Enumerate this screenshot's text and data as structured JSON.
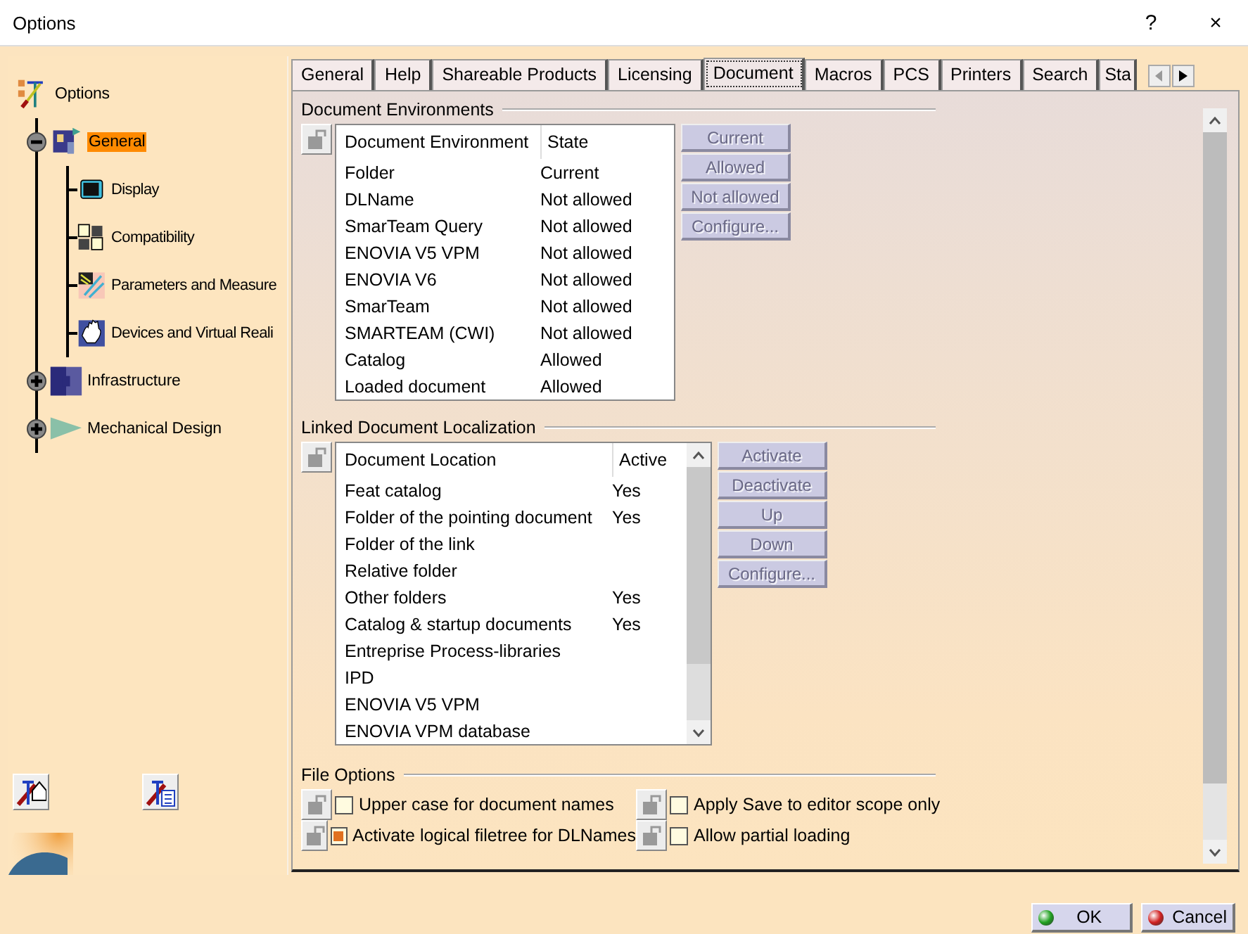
{
  "window": {
    "title": "Options",
    "help": "?",
    "close": "×"
  },
  "tree": {
    "label": "Options",
    "children": [
      {
        "label": "General",
        "selected": true,
        "expanded": true,
        "children": [
          {
            "label": "Display",
            "selected": false
          },
          {
            "label": "Compatibility",
            "selected": false
          },
          {
            "label": "Parameters and Measure",
            "selected": false
          },
          {
            "label": "Devices and Virtual Reali",
            "selected": false
          }
        ]
      },
      {
        "label": "Infrastructure",
        "selected": false,
        "expanded": false
      },
      {
        "label": "Mechanical Design",
        "selected": false,
        "expanded": false
      }
    ]
  },
  "tabs": [
    {
      "label": "General",
      "selected": false
    },
    {
      "label": "Help",
      "selected": false
    },
    {
      "label": "Shareable Products",
      "selected": false
    },
    {
      "label": "Licensing",
      "selected": false
    },
    {
      "label": "Document",
      "selected": true
    },
    {
      "label": "Macros",
      "selected": false
    },
    {
      "label": "PCS",
      "selected": false
    },
    {
      "label": "Printers",
      "selected": false
    },
    {
      "label": "Search",
      "selected": false
    },
    {
      "label": "Sta",
      "selected": false
    }
  ],
  "document_environments": {
    "title": "Document Environments",
    "columns": [
      "Document Environment",
      "State"
    ],
    "rows": [
      {
        "name": "Folder",
        "state": "Current"
      },
      {
        "name": "DLName",
        "state": "Not allowed"
      },
      {
        "name": "SmarTeam Query",
        "state": "Not allowed"
      },
      {
        "name": "ENOVIA V5 VPM",
        "state": "Not allowed"
      },
      {
        "name": "ENOVIA V6",
        "state": "Not allowed"
      },
      {
        "name": "SmarTeam",
        "state": "Not allowed"
      },
      {
        "name": "SMARTEAM (CWI)",
        "state": "Not allowed"
      },
      {
        "name": "Catalog",
        "state": "Allowed"
      },
      {
        "name": "Loaded document",
        "state": "Allowed"
      }
    ],
    "buttons": [
      {
        "label": "Current",
        "disabled": true
      },
      {
        "label": "Allowed",
        "disabled": true
      },
      {
        "label": "Not allowed",
        "disabled": true
      },
      {
        "label": "Configure...",
        "disabled": true
      }
    ]
  },
  "linked_document_localization": {
    "title": "Linked Document Localization",
    "columns": [
      "Document Location",
      "Active"
    ],
    "rows": [
      {
        "name": "Feat catalog",
        "active": "Yes"
      },
      {
        "name": "Folder of the pointing document",
        "active": "Yes"
      },
      {
        "name": "Folder of the link"
      },
      {
        "name": "Relative folder"
      },
      {
        "name": "Other folders",
        "active": "Yes"
      },
      {
        "name": "Catalog & startup documents",
        "active": "Yes"
      },
      {
        "name": "Entreprise Process-libraries"
      },
      {
        "name": "IPD"
      },
      {
        "name": "ENOVIA V5 VPM"
      },
      {
        "name": "ENOVIA VPM  database"
      }
    ],
    "buttons": [
      {
        "label": "Activate",
        "disabled": true
      },
      {
        "label": "Deactivate",
        "disabled": true
      },
      {
        "label": "Up",
        "disabled": true
      },
      {
        "label": "Down",
        "disabled": true
      },
      {
        "label": "Configure...",
        "disabled": true
      }
    ]
  },
  "file_options": {
    "title": "File Options",
    "options": [
      {
        "label": "Upper case for document names",
        "checked": false
      },
      {
        "label": "Apply Save to editor scope only",
        "checked": false
      },
      {
        "label": "Activate logical filetree for DLNames",
        "checked": true
      },
      {
        "label": "Allow partial loading",
        "checked": false
      }
    ]
  },
  "dialog_buttons": [
    {
      "label": "OK",
      "kind": "ok"
    },
    {
      "label": "Cancel",
      "kind": "cancel"
    }
  ]
}
